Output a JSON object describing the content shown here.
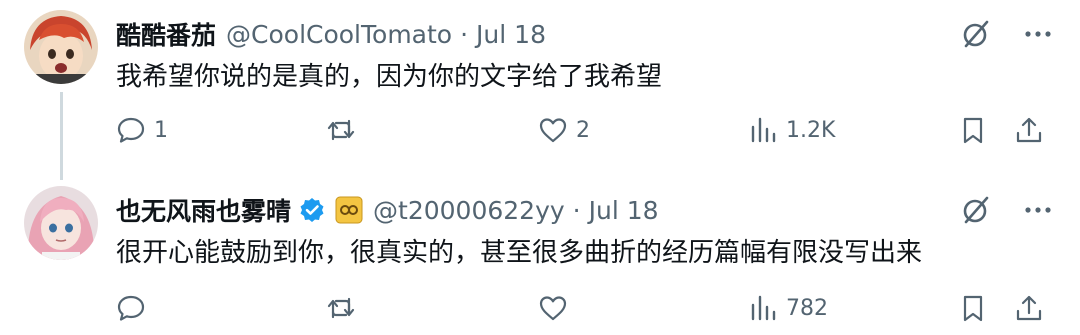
{
  "tweets": [
    {
      "display_name": "酷酷番茄",
      "handle": "@CoolCoolTomato",
      "separator": "·",
      "date": "Jul 18",
      "text": "我希望你说的是真的，因为你的文字给了我希望",
      "replies": "1",
      "retweets": "",
      "likes": "2",
      "views": "1.2K"
    },
    {
      "display_name": "也无风雨也雾晴",
      "handle": "@t20000622yy",
      "separator": "·",
      "date": "Jul 18",
      "text": "很开心能鼓励到你，很真实的，甚至很多曲折的经历篇幅有限没写出来",
      "replies": "",
      "retweets": "",
      "likes": "",
      "views": "782"
    }
  ],
  "colors": {
    "text_primary": "#0f1419",
    "text_secondary": "#536471",
    "verified_blue": "#1d9bf0",
    "affiliate_gold": "#e8b527",
    "thread_line": "#cfd9de"
  },
  "icons": [
    "reply-icon",
    "retweet-icon",
    "like-icon",
    "views-icon",
    "bookmark-icon",
    "share-icon",
    "grok-icon",
    "more-icon",
    "verified-badge-icon",
    "affiliate-badge-icon"
  ]
}
